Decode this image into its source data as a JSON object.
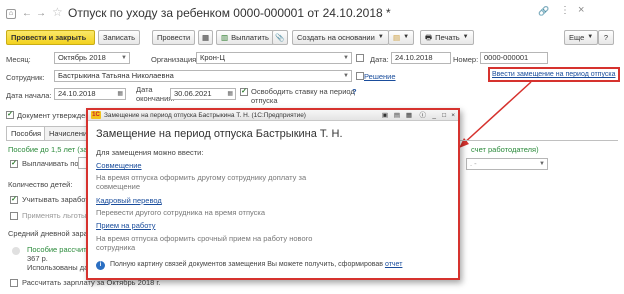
{
  "window": {
    "title": "Отпуск по уходу за ребенком 0000-000001 от 24.10.2018 *"
  },
  "toolbar": {
    "post_close": "Провести и закрыть",
    "save": "Записать",
    "post": "Провести",
    "pay": "Выплатить",
    "create_based": "Создать на основании",
    "print": "Печать",
    "more": "Еще",
    "help": "?"
  },
  "form": {
    "month_label": "Месяц:",
    "month_value": "Октябрь 2018",
    "org_label": "Организация:",
    "org_value": "Крон-Ц",
    "date_label": "Дата:",
    "date_value": "24.10.2018",
    "number_label": "Номер:",
    "number_value": "0000-000001",
    "employee_label": "Сотрудник:",
    "employee_value": "Бастрыкина Татьяна Николаевна",
    "decision_link": "Решение",
    "replacement_link": "Ввести замещение на период отпуска",
    "start_label": "Дата начала:",
    "start_value": "24.10.2018",
    "end_label_1": "Дата",
    "end_label_2": "окончания:",
    "end_value": "30.06.2021",
    "free_rate_1": "Освободить ставку на период",
    "free_rate_2": "отпуска",
    "free_rate_help": "?",
    "approved_label": "Документ утвержден",
    "side_text": "счет работодателя)",
    "side_field": ". -",
    "tabs": [
      "Пособия",
      "Начисление"
    ],
    "benefits_heading": "Пособие до 1,5 лет (за",
    "pay_to_label": "Выплачивать по",
    "children_label": "Количество детей:",
    "consider_earn": "Учитывать заработ",
    "apply_benefits": "Применять льготы",
    "avg_earn": "Средний дневной зарабо",
    "allowance_calc": "Пособие рассчита",
    "allowance_amount": "367 р.",
    "used_data": "Использованы да",
    "recalc": "Рассчитать зарплату за Октябрь 2018 г."
  },
  "popup": {
    "titlebar": "Замещение на период отпуска Бастрыкина Т. Н.  (1С:Предприятие)",
    "heading": "Замещение на период отпуска Бастрыкина Т. Н.",
    "intro": "Для замещения можно ввести:",
    "items": [
      {
        "label": "Совмещение",
        "desc": "На время отпуска оформить другому сотруднику доплату за совмещение"
      },
      {
        "label": "Кадровый перевод",
        "desc": "Перевести другого сотрудника на время отпуска"
      },
      {
        "label": "Прием на работу",
        "desc": "На время отпуска оформить срочный прием на работу нового сотрудника"
      }
    ],
    "footer": "Полную картину связей документов замещения Вы можете получить, сформировав",
    "footer_link": "отчет"
  }
}
